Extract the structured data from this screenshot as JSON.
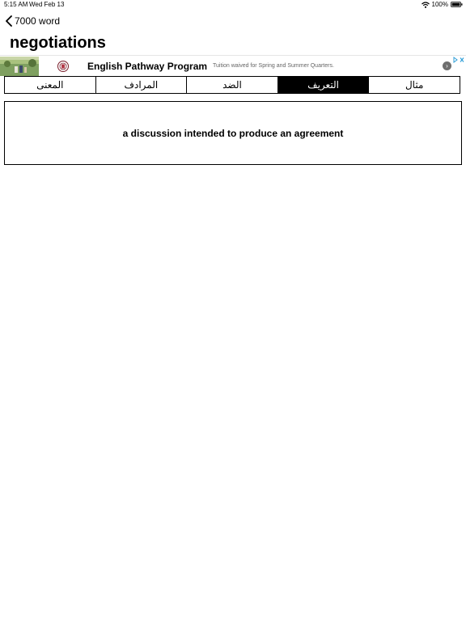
{
  "status_bar": {
    "time": "5:15 AM",
    "date": "Wed Feb 13",
    "battery": "100%"
  },
  "nav": {
    "back_label": "7000 word"
  },
  "title": "negotiations",
  "ad": {
    "title": "English Pathway Program",
    "subtitle": "Tuition waived for Spring and Summer Quarters.",
    "go_glyph": "›"
  },
  "tabs": [
    {
      "label": "المعنى",
      "active": false
    },
    {
      "label": "المرادف",
      "active": false
    },
    {
      "label": "الضد",
      "active": false
    },
    {
      "label": "التعريف",
      "active": true
    },
    {
      "label": "مثال",
      "active": false
    }
  ],
  "definition": "a discussion intended to produce an agreement"
}
